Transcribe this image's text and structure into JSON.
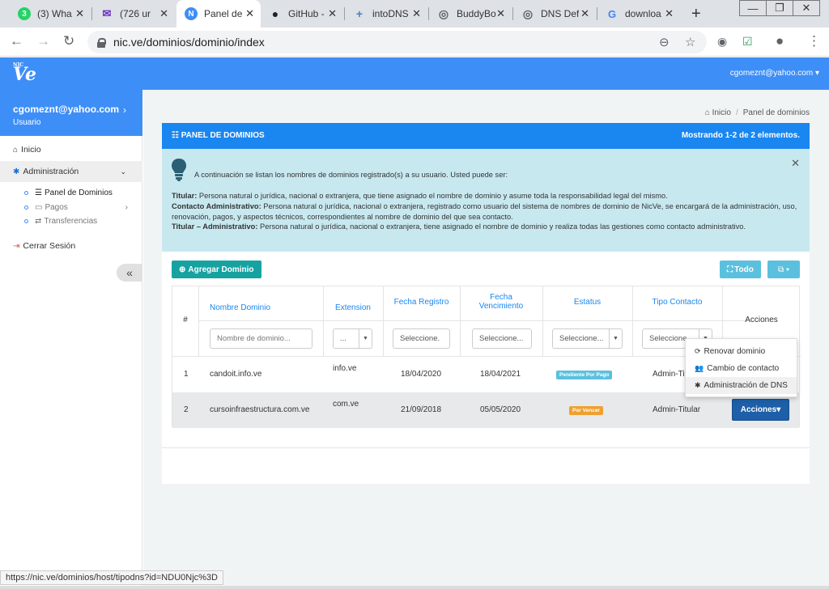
{
  "browser": {
    "tabs": [
      {
        "title": "(3) Wha",
        "icon": "whatsapp-icon",
        "favicon_glyph": "3",
        "color": "#25d366"
      },
      {
        "title": "(726 ur",
        "icon": "mail-icon",
        "favicon_glyph": "✉",
        "color": "#6b2fbf"
      },
      {
        "title": "Panel de",
        "icon": "nicve-icon",
        "favicon_glyph": "N",
        "color": "#3e8ef7"
      },
      {
        "title": "GitHub -",
        "icon": "github-icon",
        "favicon_glyph": "●",
        "color": "#222222"
      },
      {
        "title": "intoDNS",
        "icon": "intodns-icon",
        "favicon_glyph": "+",
        "color": "#4a7fc1"
      },
      {
        "title": "BuddyBo",
        "icon": "globe-icon",
        "favicon_glyph": "◎",
        "color": "#5f6368"
      },
      {
        "title": "DNS Def",
        "icon": "globe-icon",
        "favicon_glyph": "◎",
        "color": "#5f6368"
      },
      {
        "title": "downloa",
        "icon": "google-icon",
        "favicon_glyph": "G",
        "color": "#4285f4"
      }
    ],
    "active_tab": 2,
    "url": "nic.ve/dominios/dominio/index",
    "status_url": "https://nic.ve/dominios/host/tipodns?id=NDU0Njc%3D"
  },
  "header": {
    "logo_small": "NIC",
    "logo_text": "Ve",
    "user_email": "cgomeznt@yahoo.com"
  },
  "sidebar": {
    "user_email": "cgomeznt@yahoo.com",
    "user_role": "Usuario",
    "items": {
      "inicio": "Inicio",
      "administracion": "Administración",
      "panel": "Panel de Dominios",
      "pagos": "Pagos",
      "transferencias": "Transferencias",
      "logout": "Cerrar Sesión"
    }
  },
  "breadcrumb": {
    "home": "Inicio",
    "current": "Panel de dominios"
  },
  "panel": {
    "title": "PANEL DE DOMINIOS",
    "summary": "Mostrando 1-2 de 2 elementos."
  },
  "info": {
    "intro": "A continuación se listan los nombres de dominios registrado(s) a su usuario. Usted puede ser:",
    "titular_label": "Titular:",
    "titular_text": " Persona natural o jurídica, nacional o extranjera, que tiene asignado el nombre de dominio y asume toda la responsabilidad legal del mismo.",
    "contacto_label": "Contacto Administrativo:",
    "contacto_text": " Persona natural o jurídica, nacional o extranjera, registrado como usuario del sistema de nombres de dominio de NicVe, se encargará de la administración, uso, renovación, pagos, y aspectos técnicos, correspondientes al nombre de dominio del que sea contacto.",
    "titadm_label": "Titular – Administrativo:",
    "titadm_text": " Persona natural o jurídica, nacional o extranjera, tiene asignado el nombre de dominio y realiza todas las gestiones como contacto administrativo."
  },
  "toolbar": {
    "add_label": "Agregar Dominio",
    "all_label": "Todo"
  },
  "table": {
    "headers": {
      "num": "#",
      "nombre": "Nombre Dominio",
      "extension": "Extension",
      "fecha_registro": "Fecha Registro",
      "fecha_venc_1": "Fecha",
      "fecha_venc_2": "Vencimiento",
      "estatus": "Estatus",
      "tipo": "Tipo Contacto",
      "acciones": "Acciones"
    },
    "filters": {
      "nombre_placeholder": "Nombre de dominio...",
      "extension_value": "...",
      "fecha_registro_placeholder": "Seleccione.",
      "fecha_venc_placeholder": "Seleccione...",
      "estatus_value": "Seleccione...",
      "tipo_value": "Seleccione..."
    },
    "rows": [
      {
        "num": "1",
        "nombre": "candoit.info.ve",
        "extension": "info.ve",
        "fecha_registro": "18/04/2020",
        "fecha_venc": "18/04/2021",
        "estatus": "Pendiente Por Pago",
        "tipo": "Admin-Titular"
      },
      {
        "num": "2",
        "nombre": "cursoinfraestructura.com.ve",
        "extension": "com.ve",
        "fecha_registro": "21/09/2018",
        "fecha_venc": "05/05/2020",
        "estatus": "Por Vencer",
        "tipo": "Admin-Titular",
        "acciones": "Acciones"
      }
    ]
  },
  "dropdown": {
    "renovar": "Renovar dominio",
    "cambio": "Cambio de contacto",
    "dns": "Administración de DNS"
  },
  "colors": {
    "primary": "#3e8ef7",
    "panel_header": "#1a86f0",
    "info_bg": "#c8e8f0",
    "teal": "#17a2a2"
  }
}
